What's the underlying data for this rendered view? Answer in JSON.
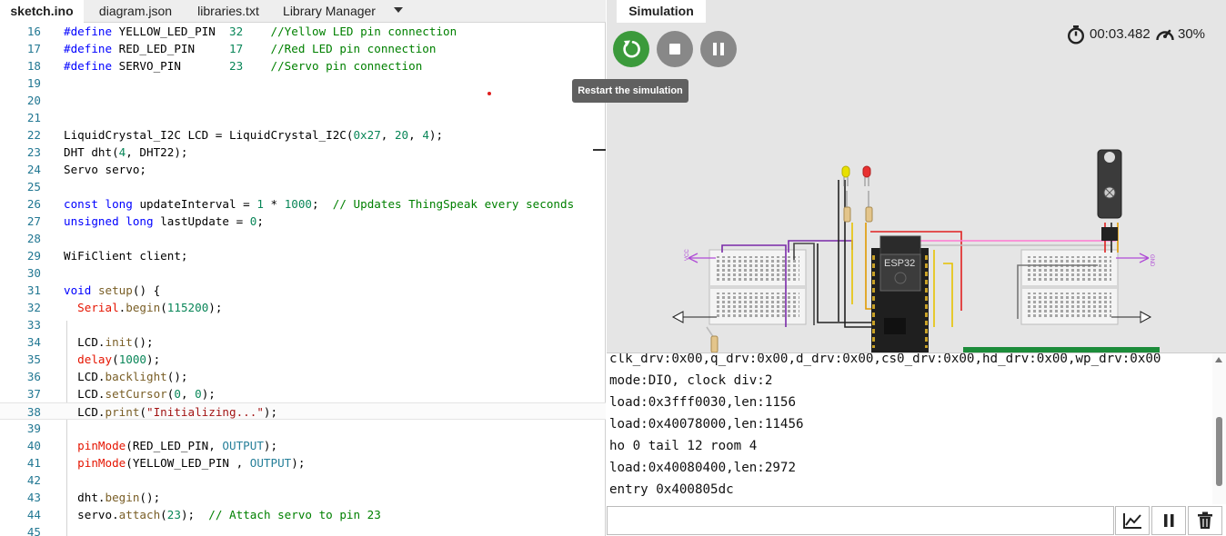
{
  "editor": {
    "tabs": [
      {
        "label": "sketch.ino",
        "active": true
      },
      {
        "label": "diagram.json"
      },
      {
        "label": "libraries.txt"
      },
      {
        "label": "Library Manager"
      }
    ],
    "lines": [
      {
        "n": "16",
        "html": "<span class=\"kw\">#define</span> YELLOW_LED_PIN  <span class=\"nm\">32</span>    <span class=\"cm\">//Yellow LED pin connection</span>"
      },
      {
        "n": "17",
        "html": "<span class=\"kw\">#define</span> RED_LED_PIN     <span class=\"nm\">17</span>    <span class=\"cm\">//Red LED pin connection</span>"
      },
      {
        "n": "18",
        "html": "<span class=\"kw\">#define</span> SERVO_PIN       <span class=\"nm\">23</span>    <span class=\"cm\">//Servo pin connection</span>"
      },
      {
        "n": "19",
        "html": ""
      },
      {
        "n": "20",
        "html": ""
      },
      {
        "n": "21",
        "html": ""
      },
      {
        "n": "22",
        "html": "LiquidCrystal_I2C LCD = LiquidCrystal_I2C(<span class=\"nm\">0x27</span>, <span class=\"nm\">20</span>, <span class=\"nm\">4</span>);"
      },
      {
        "n": "23",
        "html": "DHT dht(<span class=\"nm\">4</span>, DHT22);"
      },
      {
        "n": "24",
        "html": "Servo servo;"
      },
      {
        "n": "25",
        "html": ""
      },
      {
        "n": "26",
        "html": "<span class=\"kw\">const</span> <span class=\"kw\">long</span> updateInterval = <span class=\"nm\">1</span> * <span class=\"nm\">1000</span>;  <span class=\"cm\">// Updates ThingSpeak every seconds</span>"
      },
      {
        "n": "27",
        "html": "<span class=\"kw\">unsigned</span> <span class=\"kw\">long</span> lastUpdate = <span class=\"nm\">0</span>;"
      },
      {
        "n": "28",
        "html": ""
      },
      {
        "n": "29",
        "html": "WiFiClient client;"
      },
      {
        "n": "30",
        "html": ""
      },
      {
        "n": "31",
        "html": "<span class=\"kw\">void</span> <span class=\"fn\">setup</span>() {"
      },
      {
        "n": "32",
        "html": "  <span class=\"red\">Serial</span>.<span class=\"fn\">begin</span>(<span class=\"nm\">115200</span>);"
      },
      {
        "n": "33",
        "html": ""
      },
      {
        "n": "34",
        "html": "  LCD.<span class=\"fn\">init</span>();"
      },
      {
        "n": "35",
        "html": "  <span class=\"red\">delay</span>(<span class=\"nm\">1000</span>);"
      },
      {
        "n": "36",
        "html": "  LCD.<span class=\"fn\">backlight</span>();"
      },
      {
        "n": "37",
        "html": "  LCD.<span class=\"fn\">setCursor</span>(<span class=\"nm\">0</span>, <span class=\"nm\">0</span>);"
      },
      {
        "n": "38",
        "html": "  LCD.<span class=\"fn\">print</span>(<span class=\"st\">\"Initializing...\"</span>);",
        "current": true
      },
      {
        "n": "39",
        "html": ""
      },
      {
        "n": "40",
        "html": "  <span class=\"red\">pinMode</span>(RED_LED_PIN, <span class=\"cs\">OUTPUT</span>);"
      },
      {
        "n": "41",
        "html": "  <span class=\"red\">pinMode</span>(YELLOW_LED_PIN , <span class=\"cs\">OUTPUT</span>);"
      },
      {
        "n": "42",
        "html": ""
      },
      {
        "n": "43",
        "html": "  dht.<span class=\"fn\">begin</span>();"
      },
      {
        "n": "44",
        "html": "  servo.<span class=\"fn\">attach</span>(<span class=\"nm\">23</span>);  <span class=\"cm\">// Attach servo to pin 23</span>"
      },
      {
        "n": "45",
        "html": ""
      }
    ]
  },
  "simulation": {
    "tab_label": "Simulation",
    "tooltip": "Restart the simulation",
    "timer": "00:03.482",
    "speed": "30%",
    "colors": {
      "run_green": "#3b9a3b",
      "control_gray": "#888888"
    },
    "icons": [
      "restart-icon",
      "stop-icon",
      "pause-icon",
      "stopwatch-icon",
      "speedometer-icon"
    ],
    "labels": {
      "chip": "ESP32",
      "vcc_left": "VCC",
      "gnd_right": "GND"
    }
  },
  "serial_monitor": {
    "lines": [
      "clk_drv:0x00,q_drv:0x00,d_drv:0x00,cs0_drv:0x00,hd_drv:0x00,wp_drv:0x00",
      "mode:DIO, clock div:2",
      "load:0x3fff0030,len:1156",
      "load:0x40078000,len:11456",
      "ho 0 tail 12 room 4",
      "load:0x40080400,len:2972",
      "entry 0x400805dc"
    ],
    "input_value": "",
    "buttons": [
      "chart-icon",
      "pause-icon",
      "trash-icon"
    ]
  }
}
